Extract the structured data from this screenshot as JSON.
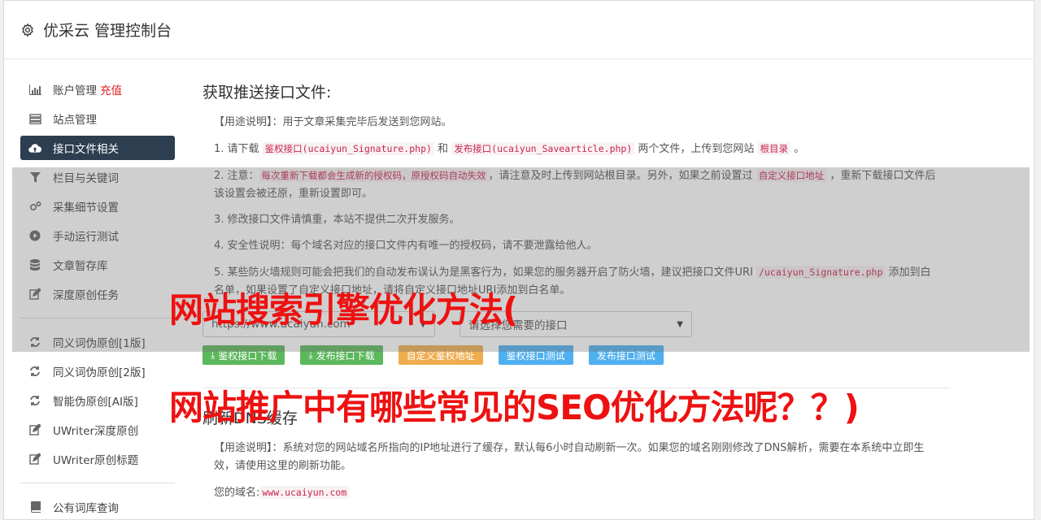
{
  "header": {
    "title": "优采云 管理控制台",
    "icon": "gear-icon"
  },
  "sidebar": {
    "items": [
      {
        "label": "账户管理",
        "badge": "充值",
        "icon": "bar-chart-icon"
      },
      {
        "label": "站点管理",
        "icon": "server-icon"
      },
      {
        "label": "接口文件相关",
        "icon": "cloud-upload-icon",
        "active": true
      },
      {
        "label": "栏目与关键词",
        "icon": "filter-icon"
      },
      {
        "label": "采集细节设置",
        "icon": "cogs-icon"
      },
      {
        "label": "手动运行测试",
        "icon": "play-icon"
      },
      {
        "label": "文章暂存库",
        "icon": "database-icon"
      },
      {
        "label": "深度原创任务",
        "icon": "edit-icon"
      }
    ],
    "items2": [
      {
        "label": "同义词伪原创[1版]",
        "icon": "refresh-icon"
      },
      {
        "label": "同义词伪原创[2版]",
        "icon": "refresh-icon"
      },
      {
        "label": "智能伪原创[AI版]",
        "icon": "refresh-icon"
      },
      {
        "label": "UWriter深度原创",
        "icon": "edit-icon"
      },
      {
        "label": "UWriter原创标题",
        "icon": "edit-icon"
      }
    ],
    "items3": [
      {
        "label": "公有词库查询",
        "icon": "book-icon"
      }
    ]
  },
  "section1": {
    "title": "获取推送接口文件:",
    "usage": "【用途说明】：用于文章采集完毕后发送到您网站。",
    "p1": {
      "a": "1. 请下载 ",
      "c1": "鉴权接口(ucaiyun_Signature.php)",
      "b": " 和 ",
      "c2": "发布接口(ucaiyun_Savearticle.php)",
      "d": " 两个文件，上传到您网站 ",
      "c3": "根目录",
      "e": " 。"
    },
    "p2": {
      "a": "2. 注意：",
      "c1": "每次重新下载都会生成新的授权码，原授权码自动失效",
      "b": "，请注意及时上传到网站根目录。另外，如果之前设置过 ",
      "c2": "自定义接口地址",
      "d": " ，重新下载接口文件后该设置会被还原，重新设置即可。"
    },
    "p3": "3. 修改接口文件请慎重，本站不提供二次开发服务。",
    "p4": "4. 安全性说明：每个域名对应的接口文件内有唯一的授权码，请不要泄露给他人。",
    "p5": {
      "a": "5. 某些防火墙规则可能会把我们的自动发布误认为是黑客行为，如果您的服务器开启了防火墙，建议把接口文件URI ",
      "c1": "/ucaiyun_Signature.php",
      "b": " 添加到白名单，如果设置了自定义接口地址，请将自定义接口地址URI添加到白名单。"
    },
    "site_select": "https://www.ucaiyun.com",
    "api_select": "请选择您需要的接口",
    "buttons": {
      "auth_download": "鉴权接口下载",
      "publish_download": "发布接口下载",
      "custom_auth": "自定义鉴权地址",
      "auth_test": "鉴权接口测试",
      "publish_test": "发布接口测试"
    }
  },
  "section2": {
    "title": "刷新DNS缓存",
    "usage": "【用途说明】：系统对您的网站域名所指向的IP地址进行了缓存，默认每6小时自动刷新一次。如果您的域名刚刚修改了DNS解析，需要在本系统中立即生效，请使用这里的刷新功能。",
    "domain_label": "您的域名:",
    "domain_value": "www.ucaiyun.com"
  },
  "watermark": {
    "line1": "网站搜索引擎优化方法(",
    "line2": "网站推广中有哪些常见的SEO优化方法呢？？)"
  }
}
